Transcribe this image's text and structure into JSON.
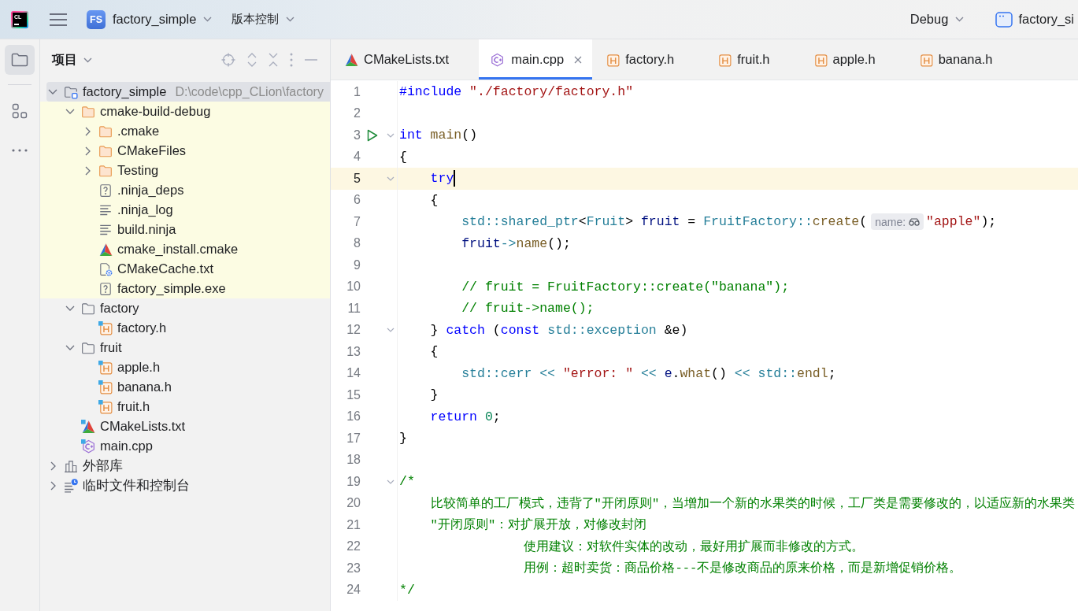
{
  "title_bar": {
    "logo": "CL",
    "project_badge": "FS",
    "project": "factory_simple",
    "vcs_menu": "版本控制",
    "configuration": "Debug",
    "run_target": "factory_si"
  },
  "tool_strip": [
    {
      "kind": "project",
      "selected": true
    },
    {
      "kind": "structure",
      "selected": false
    },
    {
      "kind": "more",
      "selected": false
    }
  ],
  "project_panel": {
    "title": "项目",
    "tree": [
      {
        "label": "factory_simple",
        "path": "D:\\code\\cpp_CLion\\factory",
        "kind": "project",
        "expanded": true,
        "selected": true,
        "excluded": false,
        "children": [
          {
            "label": "cmake-build-debug",
            "kind": "folder",
            "expanded": true,
            "selected": false,
            "excluded": true,
            "children": [
              {
                "label": ".cmake",
                "kind": "folder",
                "expanded": false,
                "selected": false,
                "excluded": true
              },
              {
                "label": "CMakeFiles",
                "kind": "folder",
                "expanded": false,
                "selected": false,
                "excluded": true
              },
              {
                "label": "Testing",
                "kind": "folder",
                "expanded": false,
                "selected": false,
                "excluded": true
              },
              {
                "label": ".ninja_deps",
                "kind": "unknown",
                "selected": false,
                "excluded": true
              },
              {
                "label": ".ninja_log",
                "kind": "text",
                "selected": false,
                "excluded": true
              },
              {
                "label": "build.ninja",
                "kind": "text",
                "selected": false,
                "excluded": true
              },
              {
                "label": "cmake_install.cmake",
                "kind": "cmake",
                "selected": false,
                "excluded": true
              },
              {
                "label": "CMakeCache.txt",
                "kind": "cmake_cache",
                "selected": false,
                "excluded": true
              },
              {
                "label": "factory_simple.exe",
                "kind": "unknown",
                "selected": false,
                "excluded": true
              }
            ]
          },
          {
            "label": "factory",
            "kind": "folder",
            "expanded": true,
            "selected": false,
            "excluded": false,
            "children": [
              {
                "label": "factory.h",
                "kind": "header",
                "selected": false,
                "excluded": false
              }
            ]
          },
          {
            "label": "fruit",
            "kind": "folder",
            "expanded": true,
            "selected": false,
            "excluded": false,
            "children": [
              {
                "label": "apple.h",
                "kind": "header",
                "selected": false,
                "excluded": false
              },
              {
                "label": "banana.h",
                "kind": "header",
                "selected": false,
                "excluded": false
              },
              {
                "label": "fruit.h",
                "kind": "header",
                "selected": false,
                "excluded": false
              }
            ]
          },
          {
            "label": "CMakeLists.txt",
            "kind": "cmake",
            "selected": false,
            "excluded": false
          },
          {
            "label": "main.cpp",
            "kind": "cpp",
            "selected": false,
            "excluded": false
          }
        ]
      },
      {
        "label": "外部库",
        "kind": "library",
        "expanded": false,
        "selected": false,
        "excluded": false
      },
      {
        "label": "临时文件和控制台",
        "kind": "scratches",
        "expanded": false,
        "selected": false,
        "excluded": false
      }
    ]
  },
  "editor": {
    "tabs": [
      {
        "label": "CMakeLists.txt",
        "kind": "cmake",
        "selected": false
      },
      {
        "label": "main.cpp",
        "kind": "cpp",
        "selected": true
      },
      {
        "label": "factory.h",
        "kind": "header",
        "selected": false
      },
      {
        "label": "fruit.h",
        "kind": "header",
        "selected": false
      },
      {
        "label": "apple.h",
        "kind": "header",
        "selected": false
      },
      {
        "label": "banana.h",
        "kind": "header",
        "selected": false
      }
    ],
    "lines": [
      {
        "number": "1",
        "current": false,
        "fold": false,
        "run": false,
        "tokens": [
          {
            "text": "#include",
            "kind": "keyword"
          },
          {
            "text": " \"./factory/factory.h\"",
            "kind": "string"
          }
        ]
      },
      {
        "number": "2",
        "current": false,
        "fold": false,
        "run": false
      },
      {
        "number": "3",
        "current": false,
        "fold": true,
        "run": true,
        "tokens": [
          {
            "text": "int",
            "kind": "keyword"
          },
          {
            "text": " main",
            "kind": "function"
          },
          {
            "text": "()",
            "kind": "plain"
          }
        ]
      },
      {
        "number": "4",
        "current": false,
        "fold": false,
        "run": false,
        "tokens": [
          {
            "text": "{",
            "kind": "plain"
          }
        ]
      },
      {
        "number": "5",
        "current": true,
        "fold": true,
        "run": false,
        "tokens": [
          {
            "text": "    try",
            "kind": "keyword"
          }
        ]
      },
      {
        "number": "6",
        "current": false,
        "fold": false,
        "run": false,
        "tokens": [
          {
            "text": "    {",
            "kind": "plain"
          }
        ]
      },
      {
        "number": "7",
        "current": false,
        "fold": false,
        "run": false,
        "tokens": [
          {
            "text": "        std::shared_ptr",
            "kind": "type"
          },
          {
            "text": "<",
            "kind": "plain"
          },
          {
            "text": "Fruit",
            "kind": "type"
          },
          {
            "text": "> ",
            "kind": "plain"
          },
          {
            "text": "fruit",
            "kind": "variable"
          },
          {
            "text": " = ",
            "kind": "plain"
          },
          {
            "text": "FruitFactory::",
            "kind": "type"
          },
          {
            "text": "create",
            "kind": "function"
          },
          {
            "text": "(",
            "kind": "plain"
          },
          {
            "text": "name:",
            "kind": "hint"
          },
          {
            "text": "\"apple\"",
            "kind": "string"
          },
          {
            "text": ");",
            "kind": "plain"
          }
        ]
      },
      {
        "number": "8",
        "current": false,
        "fold": false,
        "run": false,
        "tokens": [
          {
            "text": "        fruit",
            "kind": "variable"
          },
          {
            "text": "->",
            "kind": "operator"
          },
          {
            "text": "name",
            "kind": "function"
          },
          {
            "text": "();",
            "kind": "plain"
          }
        ]
      },
      {
        "number": "9",
        "current": false,
        "fold": false,
        "run": false
      },
      {
        "number": "10",
        "current": false,
        "fold": false,
        "run": false,
        "tokens": [
          {
            "text": "        // fruit = FruitFactory::create(\"banana\");",
            "kind": "comment"
          }
        ]
      },
      {
        "number": "11",
        "current": false,
        "fold": false,
        "run": false,
        "tokens": [
          {
            "text": "        // fruit->name();",
            "kind": "comment"
          }
        ]
      },
      {
        "number": "12",
        "current": false,
        "fold": true,
        "run": false,
        "tokens": [
          {
            "text": "    } ",
            "kind": "plain"
          },
          {
            "text": "catch",
            "kind": "keyword"
          },
          {
            "text": " (",
            "kind": "plain"
          },
          {
            "text": "const",
            "kind": "keyword"
          },
          {
            "text": " std::exception",
            "kind": "type"
          },
          {
            "text": " &e)",
            "kind": "plain"
          }
        ]
      },
      {
        "number": "13",
        "current": false,
        "fold": false,
        "run": false,
        "tokens": [
          {
            "text": "    {",
            "kind": "plain"
          }
        ]
      },
      {
        "number": "14",
        "current": false,
        "fold": false,
        "run": false,
        "tokens": [
          {
            "text": "        std::cerr",
            "kind": "type"
          },
          {
            "text": " << ",
            "kind": "operator"
          },
          {
            "text": "\"error: \"",
            "kind": "string"
          },
          {
            "text": " << ",
            "kind": "operator"
          },
          {
            "text": "e",
            "kind": "variable"
          },
          {
            "text": ".",
            "kind": "plain"
          },
          {
            "text": "what",
            "kind": "function"
          },
          {
            "text": "() ",
            "kind": "plain"
          },
          {
            "text": "<< ",
            "kind": "operator"
          },
          {
            "text": "std::",
            "kind": "type"
          },
          {
            "text": "endl",
            "kind": "function"
          },
          {
            "text": ";",
            "kind": "plain"
          }
        ]
      },
      {
        "number": "15",
        "current": false,
        "fold": false,
        "run": false,
        "tokens": [
          {
            "text": "    }",
            "kind": "plain"
          }
        ]
      },
      {
        "number": "16",
        "current": false,
        "fold": false,
        "run": false,
        "tokens": [
          {
            "text": "    return",
            "kind": "keyword"
          },
          {
            "text": " 0",
            "kind": "number"
          },
          {
            "text": ";",
            "kind": "plain"
          }
        ]
      },
      {
        "number": "17",
        "current": false,
        "fold": false,
        "run": false,
        "tokens": [
          {
            "text": "}",
            "kind": "plain"
          }
        ]
      },
      {
        "number": "18",
        "current": false,
        "fold": false,
        "run": false
      },
      {
        "number": "19",
        "current": false,
        "fold": true,
        "run": false,
        "tokens": [
          {
            "text": "/*",
            "kind": "comment"
          }
        ]
      },
      {
        "number": "20",
        "current": false,
        "fold": false,
        "run": false,
        "tokens": [
          {
            "text": "    比较简单的工厂模式，违背了\"开闭原则\"，当增加一个新的水果类的时候，工厂类是需要修改的，以适应新的水果类",
            "kind": "comment"
          }
        ]
      },
      {
        "number": "21",
        "current": false,
        "fold": false,
        "run": false,
        "tokens": [
          {
            "text": "    \"开闭原则\"：对扩展开放，对修改封闭",
            "kind": "comment"
          }
        ]
      },
      {
        "number": "22",
        "current": false,
        "fold": false,
        "run": false,
        "tokens": [
          {
            "text": "                使用建议：对软件实体的改动，最好用扩展而非修改的方式。",
            "kind": "comment"
          }
        ]
      },
      {
        "number": "23",
        "current": false,
        "fold": false,
        "run": false,
        "tokens": [
          {
            "text": "                用例：超时卖货：商品价格---不是修改商品的原来价格，而是新增促销价格。",
            "kind": "comment"
          }
        ]
      },
      {
        "number": "24",
        "current": false,
        "fold": false,
        "run": false,
        "tokens": [
          {
            "text": "*/",
            "kind": "comment"
          }
        ]
      }
    ]
  }
}
